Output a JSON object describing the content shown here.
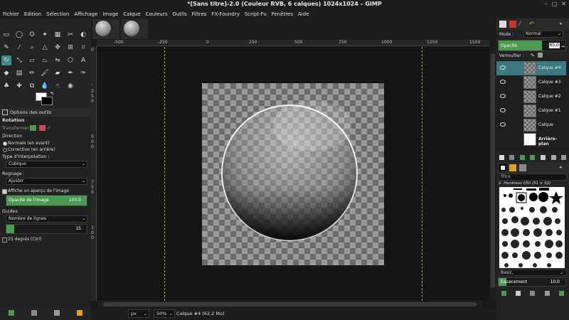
{
  "window": {
    "title": "*[Sans titre]-2.0 (Couleur RVB, 6 calques) 1024x1024 – GIMP"
  },
  "menu": [
    "Fichier",
    "Edition",
    "Sélection",
    "Affichage",
    "Image",
    "Calque",
    "Couleurs",
    "Outils",
    "Filtres",
    "FX-Foundry",
    "Script-Fu",
    "Fenêtres",
    "Aide"
  ],
  "tool_options": {
    "tab_label": "Options des outils",
    "heading": "Rotation",
    "transform_label": "Transformer :",
    "direction_label": "Direction",
    "direction_normal": "Normale (en avant)",
    "direction_corrective": "Corrective (en arrière)",
    "interpolation_label": "Type d'interpolation :",
    "interpolation_value": "Cubique",
    "clipping_label": "Rognage :",
    "clipping_value": "Ajuster",
    "preview_label": "Affiche un aperçu de l'image",
    "preview_opacity_label": "Opacité de l'image",
    "preview_opacity_value": "100,0",
    "preview_opacity_fraction": 1.0,
    "guides_label": "Guides",
    "guides_value": "Nombre de lignes",
    "guides_count": "15",
    "constrain_label": "15 degrés (Ctrl)"
  },
  "rulers": {
    "top_labels": [
      "-500",
      "-250",
      "0",
      "250",
      "500",
      "750",
      "1000",
      "1250",
      "1500"
    ],
    "left_labels": [
      "0",
      "-",
      "2",
      "5",
      "0",
      "5",
      "0",
      "0",
      "7",
      "5",
      "0",
      "1",
      "0",
      "0"
    ]
  },
  "status": {
    "unit": "px",
    "zoom": "50%",
    "message": "Calque #4 (62,2 Mo)"
  },
  "layers_panel": {
    "mode_label": "Mode :",
    "mode_value": "Normal",
    "opacity_label": "Opacité",
    "opacity_value": "65,0",
    "opacity_fraction": 0.65,
    "lock_label": "Verrouiller :",
    "layers": [
      {
        "name": "Calque #4",
        "selected": true
      },
      {
        "name": "Calque #3",
        "selected": false
      },
      {
        "name": "Calque #2",
        "selected": false
      },
      {
        "name": "Calque #1",
        "selected": false
      },
      {
        "name": "Calque",
        "selected": false
      },
      {
        "name": "Arrière-plan",
        "selected": false
      }
    ]
  },
  "brushes_panel": {
    "filter_value": "filtre",
    "brush_name": "2. Hardness 050 (51 × 52)",
    "brush_set": "Basic,",
    "spacing_label": "Espacement",
    "spacing_value": "10,0"
  },
  "colors": {
    "accent_green": "#4a9a50",
    "selection_teal": "#3c7a82",
    "guide_yellow": "#a8a04e"
  }
}
